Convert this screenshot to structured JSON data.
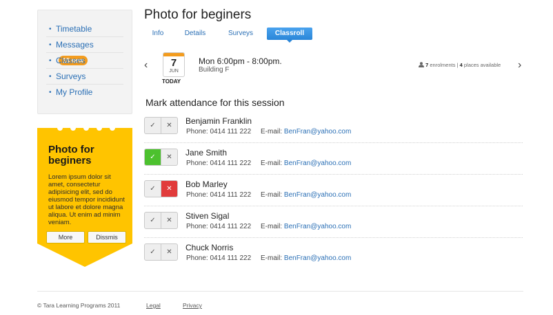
{
  "sidebar": {
    "items": [
      {
        "label": "Timetable"
      },
      {
        "label": "Messages",
        "badge": "15 new"
      },
      {
        "label": "Classes"
      },
      {
        "label": "Surveys"
      },
      {
        "label": "My Profile"
      }
    ]
  },
  "promo": {
    "title": "Photo for beginers",
    "body": "Lorem ipsum dolor sit amet, consectetur adipisicing elit, sed do eiusmod tempor incididunt ut labore et dolore magna aliqua. Ut enim ad minim veniam.",
    "more_label": "More",
    "dismiss_label": "Dissmis",
    "color": "#ffc400"
  },
  "main": {
    "title": "Photo for beginers",
    "tabs": [
      "Info",
      "Details",
      "Surveys",
      "Classroll"
    ],
    "active_tab": "Classroll"
  },
  "session": {
    "day": "7",
    "month": "JUN",
    "today_label": "TODAY",
    "time": "Mon 6:00pm - 8:00pm.",
    "location": "Building F",
    "enrolments_count": "7",
    "enrolments_label": "enrolments",
    "places_count": "4",
    "places_label": "places available"
  },
  "attendance": {
    "heading": "Mark attendance for this session",
    "phone_label": "Phone:",
    "email_label": "E-mail:",
    "students": [
      {
        "name": "Benjamin Franklin",
        "phone": "0414 111 222",
        "email": "BenFran@yahoo.com",
        "status": "none"
      },
      {
        "name": "Jane Smith",
        "phone": "0414 111 222",
        "email": "BenFran@yahoo.com",
        "status": "present"
      },
      {
        "name": "Bob Marley",
        "phone": "0414 111 222",
        "email": "BenFran@yahoo.com",
        "status": "absent"
      },
      {
        "name": "Stiven Sigal",
        "phone": "0414 111 222",
        "email": "BenFran@yahoo.com",
        "status": "none"
      },
      {
        "name": "Chuck Norris",
        "phone": "0414 111 222",
        "email": "BenFran@yahoo.com",
        "status": "none"
      }
    ]
  },
  "footer": {
    "copyright": "© Tara Learning Programs 2011",
    "legal": "Legal",
    "privacy": "Privacy"
  },
  "icons": {
    "check": "check-icon",
    "cross": "cross-icon",
    "person": "person-icon",
    "prev": "chevron-left-icon",
    "next": "chevron-right-icon",
    "calendar": "calendar-icon"
  }
}
